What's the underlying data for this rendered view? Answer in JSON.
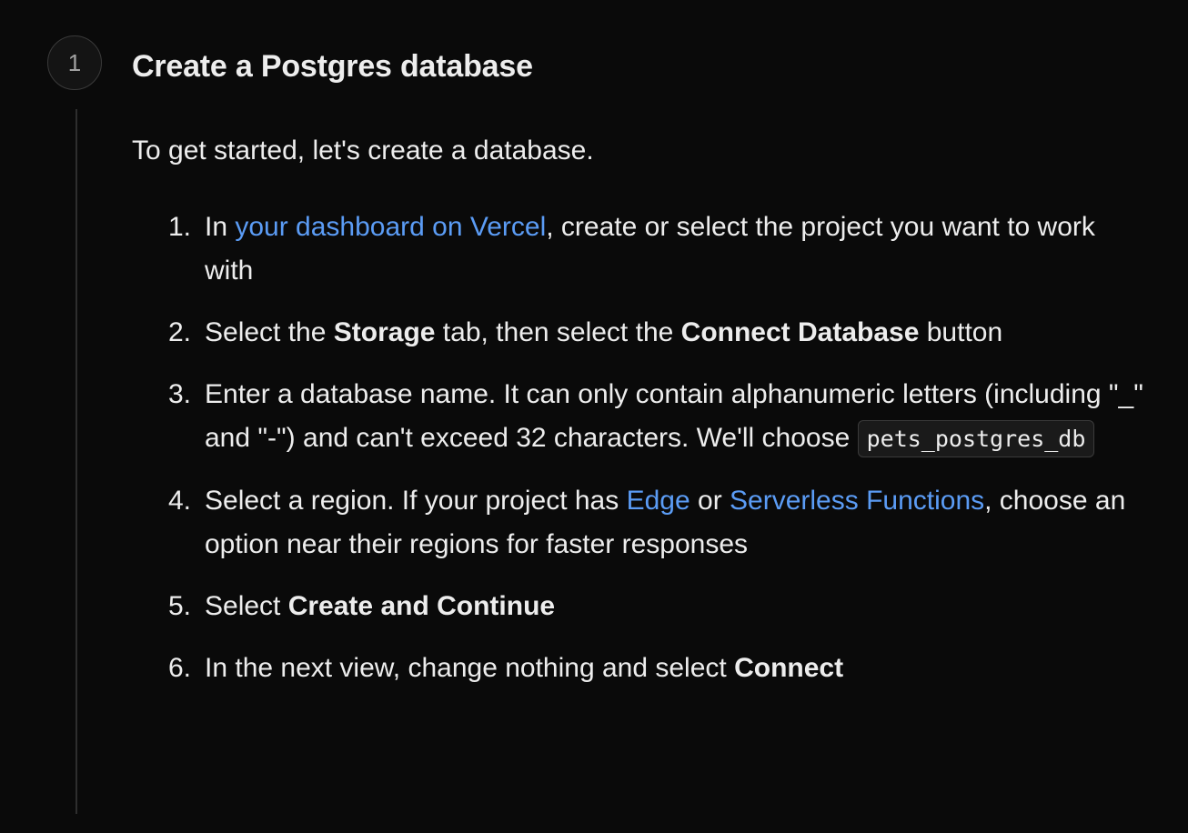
{
  "step": {
    "number": "1",
    "title": "Create a Postgres database",
    "intro": "To get started, let's create a database."
  },
  "items": [
    {
      "num": "1.",
      "t1": "In ",
      "link": "your dashboard on Vercel",
      "t2": ", create or select the project you want to work with"
    },
    {
      "num": "2.",
      "t1": "Select the ",
      "b1": "Storage",
      "t2": " tab, then select the ",
      "b2": "Connect Database",
      "t3": " button"
    },
    {
      "num": "3.",
      "t1": "Enter a database name. It can only contain alphanumeric letters (including \"_\" and \"-\") and can't exceed 32 characters. We'll choose ",
      "code": "pets_postgres_db"
    },
    {
      "num": "4.",
      "t1": "Select a region. If your project has ",
      "link1": "Edge",
      "t2": " or ",
      "link2": "Serverless Functions",
      "t3": ", choose an option near their regions for faster responses"
    },
    {
      "num": "5.",
      "t1": "Select ",
      "b1": "Create and Continue"
    },
    {
      "num": "6.",
      "t1": "In the next view, change nothing and select ",
      "b1": "Connect"
    }
  ],
  "colors": {
    "background": "#0a0a0a",
    "text": "#ededed",
    "link": "#5b9cf5"
  }
}
